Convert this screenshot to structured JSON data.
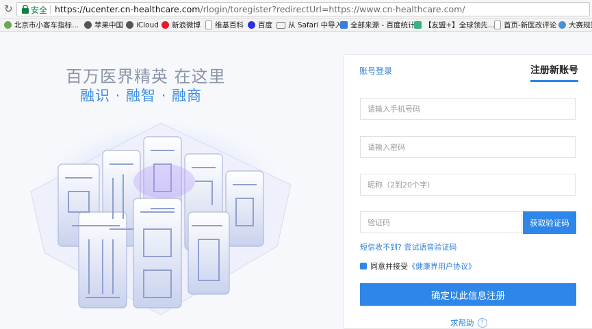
{
  "browser": {
    "secure_label": "安全",
    "url_scheme": "https://",
    "url_host": "ucenter.cn-healthcare.com",
    "url_path": "/rlogin/toregister?redirectUrl=https://www.cn-healthcare.com/"
  },
  "bookmarks": [
    {
      "label": "北京市小客车指标...",
      "icon": "globe-icon"
    },
    {
      "label": "苹果中国",
      "icon": "apple-icon"
    },
    {
      "label": "iCloud",
      "icon": "apple-icon"
    },
    {
      "label": "新浪微博",
      "icon": "weibo-icon"
    },
    {
      "label": "维基百科",
      "icon": "page-icon"
    },
    {
      "label": "百度",
      "icon": "baidu-icon"
    },
    {
      "label": "从 Safari 中导入",
      "icon": "folder-icon"
    },
    {
      "label": "全部来源 - 百度统计",
      "icon": "chart-icon"
    },
    {
      "label": "【友盟+】全球领先...",
      "icon": "umeng-icon"
    },
    {
      "label": "首页-新医改评论",
      "icon": "page-icon"
    },
    {
      "label": "大赛规则",
      "icon": "globe-icon"
    }
  ],
  "hero": {
    "title": "百万医界精英  在这里",
    "subtitle": "融识 · 融智 · 融商"
  },
  "form": {
    "tab_login": "账号登录",
    "tab_register": "注册新账号",
    "phone_placeholder": "请输入手机号码",
    "password_placeholder": "请输入密码",
    "nickname_placeholder": "昵称（2到20个字）",
    "code_placeholder": "验证码",
    "get_code_label": "获取验证码",
    "voice_code_link": "短信收不到? 尝试语音验证码",
    "agree_text": "同意并接受",
    "agreement_link": "《健康界用户协议》",
    "submit_label": "确定以此信息注册",
    "help_label": "求帮助"
  },
  "colors": {
    "accent": "#2e87e8",
    "link": "#2f7fd6",
    "secure": "#0b8043"
  }
}
